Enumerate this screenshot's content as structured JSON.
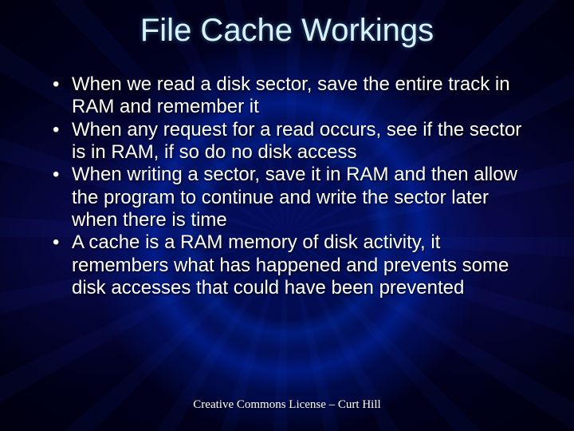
{
  "title": "File Cache Workings",
  "bullets": [
    "When we read a disk sector, save the entire track in RAM and remember it",
    "When any request for a read occurs, see if the sector is in RAM, if so do no disk access",
    "When writing a sector, save it in RAM and then allow the program to continue and write the sector later when there is time",
    "A cache is a RAM memory of disk activity, it remembers what has happened and prevents some disk accesses that could have been prevented"
  ],
  "footer": "Creative Commons License – Curt Hill"
}
